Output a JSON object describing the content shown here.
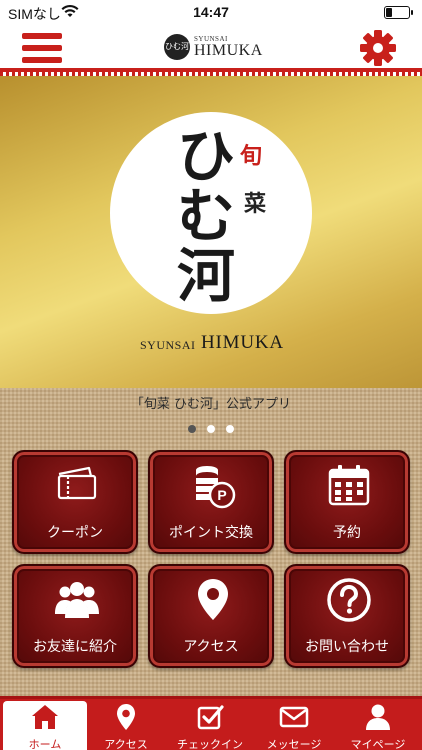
{
  "status_bar": {
    "carrier": "SIMなし",
    "time": "14:47"
  },
  "header": {
    "logo_text": "ひむ河",
    "subtitle": "SYUNSAI",
    "title": "HIMUKA",
    "menu_icon": "hamburger-menu-icon",
    "settings_icon": "gear-icon"
  },
  "hero": {
    "logo_line1": "ひ",
    "logo_line2": "む",
    "logo_line3": "河",
    "mark1": "旬",
    "mark2": "菜",
    "subtitle": "SYUNSAI",
    "name": "HIMUKA"
  },
  "caption": "「旬菜 ひむ河」公式アプリ",
  "pager": {
    "count": 3,
    "active_index": 0
  },
  "tiles": [
    {
      "label": "クーポン",
      "icon": "ticket-icon"
    },
    {
      "label": "ポイント交換",
      "icon": "coin-stack-icon"
    },
    {
      "label": "予約",
      "icon": "calendar-icon"
    },
    {
      "label": "お友達に紹介",
      "icon": "people-icon"
    },
    {
      "label": "アクセス",
      "icon": "map-pin-icon"
    },
    {
      "label": "お問い合わせ",
      "icon": "question-icon"
    }
  ],
  "tabbar": [
    {
      "label": "ホーム",
      "icon": "home-icon",
      "active": true
    },
    {
      "label": "アクセス",
      "icon": "map-pin-icon"
    },
    {
      "label": "チェックイン",
      "icon": "checkin-icon"
    },
    {
      "label": "メッセージ",
      "icon": "envelope-icon"
    },
    {
      "label": "マイページ",
      "icon": "user-icon"
    }
  ],
  "colors": {
    "brand_red": "#c8201b",
    "tile_red": "#6a0d0d",
    "gold": "#e2c75d"
  }
}
